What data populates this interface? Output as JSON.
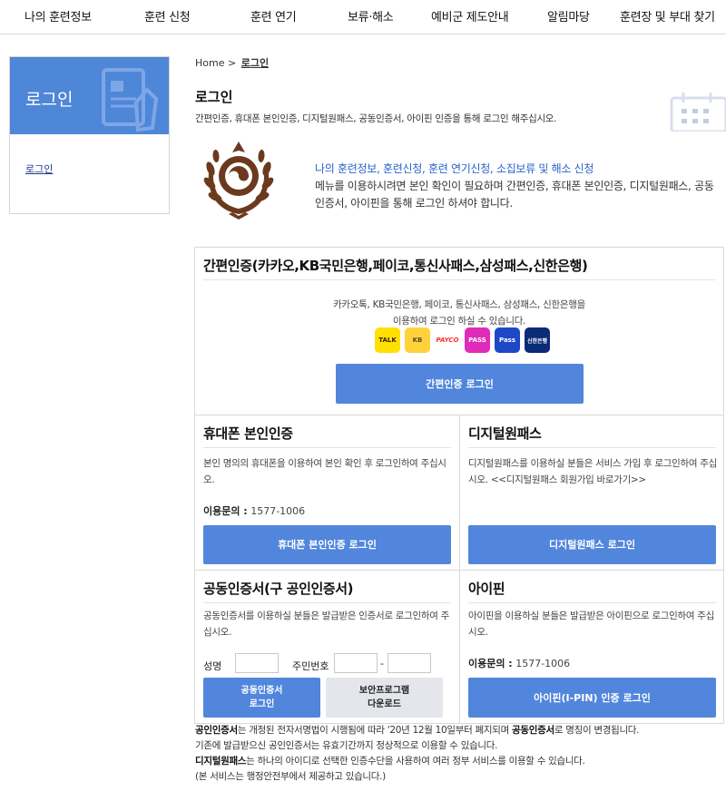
{
  "nav": [
    "나의 훈련정보",
    "훈련 신청",
    "훈련 연기",
    "보류·해소",
    "예비군 제도안내",
    "알림마당",
    "훈련장 및 부대 찾기"
  ],
  "sidebar": {
    "title": "로그인",
    "link": "로그인"
  },
  "breadcrumb": {
    "home": "Home",
    "sep": ">",
    "current": "로그인"
  },
  "page": {
    "title": "로그인",
    "subtitle": "간편인증, 휴대폰 본인인증, 디지털원패스, 공동인증서, 아이핀 인증을 통해 로그인 해주십시오."
  },
  "intro": {
    "line1": "나의 훈련정보, 훈련신청, 훈련 연기신청, 소집보류 및 해소 신청",
    "line2": "메뉴를 이용하시려면 본인 확인이 필요하며 간편인증, 휴대폰 본인인증, 디지털원패스, 공동인증서, 아이핀을 통해 로그인 하셔야 합니다."
  },
  "simple": {
    "title": "간편인증(카카오,KB국민은행,페이코,통신사패스,삼성패스,신한은행)",
    "desc1": "카카오톡, KB국민은행, 페이코, 통신사패스, 삼성패스, 신한은행을",
    "desc2": "이용하여 로그인 하실 수 있습니다.",
    "logos": [
      "TALK",
      "KB",
      "PAYCO",
      "PASS",
      "Pass",
      "신한은행"
    ],
    "button": "간편인증 로그인"
  },
  "phone": {
    "title": "휴대폰 본인인증",
    "desc": "본인 명의의 휴대폰을 이용하여 본인 확인 후 로그인하여 주십시오.",
    "inquiry_label": "이용문의 :",
    "inquiry_value": "1577-1006",
    "button": "휴대폰 본인인증 로그인"
  },
  "onepass": {
    "title": "디지털원패스",
    "desc": "디지털원패스를 이용하실 분들은 서비스 가입 후 로그인하여 주십시오.",
    "link": "<<디지털원패스 회원가입 바로가기>>",
    "button": "디지털원패스 로그인"
  },
  "cert": {
    "title": "공동인증서(구 공인인증서)",
    "desc": "공동인증서를 이용하실 분들은 발급받은 인증서로 로그인하여 주십시오.",
    "name_label": "성명",
    "rrn_label": "주민번호",
    "rrn_sep": "-",
    "button_line1": "공동인증서",
    "button_line2": "로그인",
    "download_line1": "보안프로그램",
    "download_line2": "다운로드"
  },
  "ipin": {
    "title": "아이핀",
    "desc": "아이핀을 이용하실 분들은 발급받은 아이핀으로 로그인하여 주십시오.",
    "inquiry_label": "이용문의 :",
    "inquiry_value": "1577-1006",
    "button": "아이핀(I-PIN) 인증 로그인"
  },
  "notes": {
    "n1_bold": "공인인증서",
    "n1_mid": "는 개정된 전자서명법이 시행됨에 따라 '20년 12월 10일부터 폐지되며 ",
    "n1_bold2": "공동인증서",
    "n1_end": "로 명칭이 변경됩니다.",
    "n2": "기존에 발급받으신 공인인증서는 유효기간까지 정상적으로 이용할 수 있습니다.",
    "n3_bold": "디지털원패스",
    "n3_end": "는 하나의 아이디로 선택한 인증수단을 사용하여 여러 정부 서비스를 이용할 수 있습니다.",
    "n4": "(본 서비스는 행정안전부에서 제공하고 있습니다.)"
  },
  "colors": {
    "accent": "#5186dc",
    "sidebar": "#4e86d8",
    "link": "#2a62c9"
  }
}
